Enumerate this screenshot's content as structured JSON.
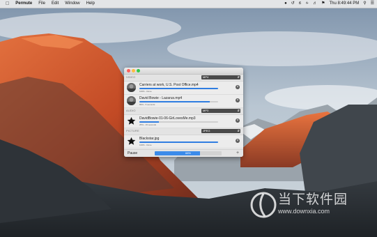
{
  "menubar": {
    "apple": "",
    "app_name": "Permute",
    "menus": [
      "File",
      "Edit",
      "Window",
      "Help"
    ],
    "clock": "Thu 8:49:44 PM"
  },
  "window": {
    "sections": [
      {
        "label": "VIDEO",
        "format": "MP4",
        "items": [
          {
            "name": "Carriers at work, U.S. Post Office.mp4",
            "status": "100% - Done",
            "progress": 1.0,
            "thumb": "video"
          },
          {
            "name": "David Bowie - Lazarus.mp4",
            "status": "89% - 5 seconds",
            "progress": 0.89,
            "thumb": "video"
          }
        ]
      },
      {
        "label": "AUDIO",
        "format": "MP3",
        "items": [
          {
            "name": "DavidBowie-01-06-GirLovesMe.mp3",
            "status": "25% - 15 seconds",
            "progress": 0.25,
            "thumb": "star"
          }
        ]
      },
      {
        "label": "PICTURE",
        "format": "JPEG",
        "items": [
          {
            "name": "Blackstar.jpg",
            "status": "100% - Done",
            "progress": 1.0,
            "thumb": "star"
          }
        ]
      }
    ],
    "bottom": {
      "pause_label": "Pause",
      "total_progress": 0.68,
      "total_label": "68%",
      "add_label": "+"
    }
  },
  "watermark": {
    "title": "当下软件园",
    "url": "www.downxia.com"
  },
  "colors": {
    "accent": "#2f7de1",
    "close": "#fc605c",
    "minimize": "#fdbc40",
    "zoom": "#34c84a"
  }
}
